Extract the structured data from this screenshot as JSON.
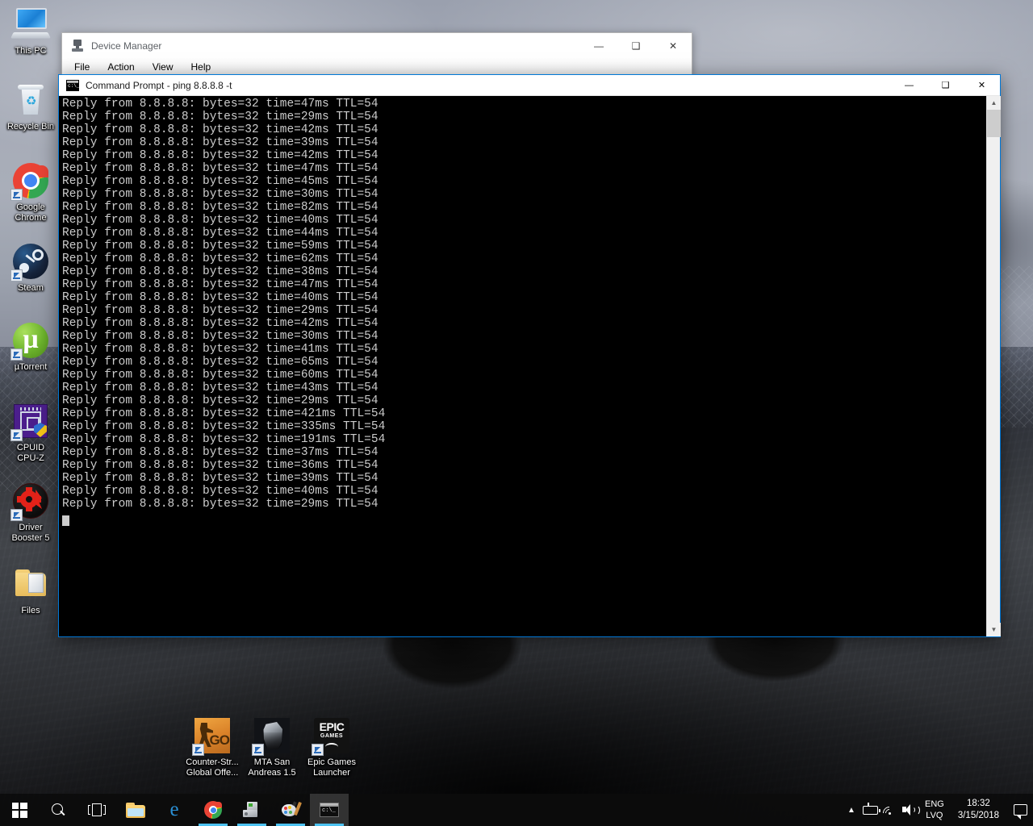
{
  "desktop": {
    "icons": [
      {
        "name": "this-pc",
        "label": "This PC",
        "shortcut": false
      },
      {
        "name": "recycle-bin",
        "label": "Recycle Bin",
        "shortcut": false
      },
      {
        "name": "google-chrome",
        "label": "Google\nChrome",
        "shortcut": true
      },
      {
        "name": "steam",
        "label": "Steam",
        "shortcut": true
      },
      {
        "name": "utorrent",
        "label": "µTorrent",
        "shortcut": true
      },
      {
        "name": "cpuid-cpu-z",
        "label": "CPUID\nCPU-Z",
        "shortcut": true
      },
      {
        "name": "driver-booster",
        "label": "Driver\nBooster 5",
        "shortcut": true
      },
      {
        "name": "files",
        "label": "Files",
        "shortcut": false
      }
    ],
    "bottom_icons": [
      {
        "name": "counter-strike-go",
        "label": "Counter-Str...\nGlobal Offe...",
        "shortcut": true
      },
      {
        "name": "mta-san-andreas",
        "label": "MTA San\nAndreas 1.5",
        "shortcut": true
      },
      {
        "name": "epic-games-launcher",
        "label": "Epic Games\nLauncher",
        "shortcut": true
      }
    ]
  },
  "device_manager": {
    "title": "Device Manager",
    "menu": [
      "File",
      "Action",
      "View",
      "Help"
    ],
    "window_buttons": {
      "minimize": "—",
      "maximize": "❑",
      "close": "✕"
    }
  },
  "command_prompt": {
    "title": "Command Prompt - ping  8.8.8.8 -t",
    "window_buttons": {
      "minimize": "—",
      "maximize": "❑",
      "close": "✕"
    },
    "scrollbar": {
      "up_arrow": "▲",
      "down_arrow": "▼"
    },
    "cursor": "block",
    "console_lines": [
      "Reply from 8.8.8.8: bytes=32 time=47ms TTL=54",
      "Reply from 8.8.8.8: bytes=32 time=29ms TTL=54",
      "Reply from 8.8.8.8: bytes=32 time=42ms TTL=54",
      "Reply from 8.8.8.8: bytes=32 time=39ms TTL=54",
      "Reply from 8.8.8.8: bytes=32 time=42ms TTL=54",
      "Reply from 8.8.8.8: bytes=32 time=47ms TTL=54",
      "Reply from 8.8.8.8: bytes=32 time=45ms TTL=54",
      "Reply from 8.8.8.8: bytes=32 time=30ms TTL=54",
      "Reply from 8.8.8.8: bytes=32 time=82ms TTL=54",
      "Reply from 8.8.8.8: bytes=32 time=40ms TTL=54",
      "Reply from 8.8.8.8: bytes=32 time=44ms TTL=54",
      "Reply from 8.8.8.8: bytes=32 time=59ms TTL=54",
      "Reply from 8.8.8.8: bytes=32 time=62ms TTL=54",
      "Reply from 8.8.8.8: bytes=32 time=38ms TTL=54",
      "Reply from 8.8.8.8: bytes=32 time=47ms TTL=54",
      "Reply from 8.8.8.8: bytes=32 time=40ms TTL=54",
      "Reply from 8.8.8.8: bytes=32 time=29ms TTL=54",
      "Reply from 8.8.8.8: bytes=32 time=42ms TTL=54",
      "Reply from 8.8.8.8: bytes=32 time=30ms TTL=54",
      "Reply from 8.8.8.8: bytes=32 time=41ms TTL=54",
      "Reply from 8.8.8.8: bytes=32 time=65ms TTL=54",
      "Reply from 8.8.8.8: bytes=32 time=60ms TTL=54",
      "Reply from 8.8.8.8: bytes=32 time=43ms TTL=54",
      "Reply from 8.8.8.8: bytes=32 time=29ms TTL=54",
      "Reply from 8.8.8.8: bytes=32 time=421ms TTL=54",
      "Reply from 8.8.8.8: bytes=32 time=335ms TTL=54",
      "Reply from 8.8.8.8: bytes=32 time=191ms TTL=54",
      "Reply from 8.8.8.8: bytes=32 time=37ms TTL=54",
      "Reply from 8.8.8.8: bytes=32 time=36ms TTL=54",
      "Reply from 8.8.8.8: bytes=32 time=39ms TTL=54",
      "Reply from 8.8.8.8: bytes=32 time=40ms TTL=54",
      "Reply from 8.8.8.8: bytes=32 time=29ms TTL=54"
    ]
  },
  "taskbar": {
    "buttons": [
      {
        "name": "start-button",
        "icon": "windows-logo-icon",
        "active": false,
        "running": false
      },
      {
        "name": "search-button",
        "icon": "search-icon",
        "active": false,
        "running": false
      },
      {
        "name": "task-view-button",
        "icon": "task-view-icon",
        "active": false,
        "running": false
      },
      {
        "name": "file-explorer-button",
        "icon": "folder-icon",
        "active": false,
        "running": false
      },
      {
        "name": "microsoft-edge-button",
        "icon": "edge-icon",
        "active": false,
        "running": false
      },
      {
        "name": "chrome-button",
        "icon": "chrome-icon",
        "active": false,
        "running": true
      },
      {
        "name": "device-manager-button",
        "icon": "device-manager-icon",
        "active": false,
        "running": true
      },
      {
        "name": "paint-button",
        "icon": "paint-icon",
        "active": false,
        "running": true
      },
      {
        "name": "command-prompt-button",
        "icon": "command-prompt-icon",
        "active": true,
        "running": true
      }
    ],
    "tray": {
      "show_hidden_icons": "^",
      "icons": [
        "battery-icon",
        "wifi-icon",
        "volume-icon"
      ],
      "language_line1": "ENG",
      "language_line2": "LVQ",
      "time": "18:32",
      "date": "3/15/2018",
      "action_center": "action-center-icon"
    }
  },
  "colors": {
    "accent": "#0078d7",
    "taskbar_indicator": "#4cc2f1",
    "console_bg": "#000000",
    "console_fg": "#cccccc",
    "close_hover": "#e81123"
  }
}
